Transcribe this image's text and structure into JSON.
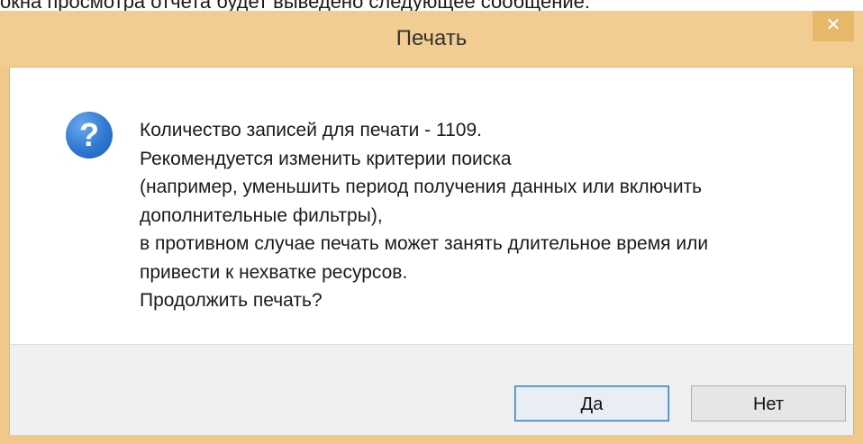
{
  "caption": "окна просмотра отчета будет выведено следующее сообщение:",
  "dialog": {
    "title": "Печать",
    "close_glyph": "✕",
    "icon": "question-icon",
    "icon_glyph": "?",
    "message_lines": [
      "Количество записей для печати - 1109.",
      "Рекомендуется изменить критерии поиска",
      "(например, уменьшить период получения данных или включить",
      "дополнительные фильтры),",
      "в противном случае печать может занять длительное время или",
      "привести к нехватке ресурсов.",
      "Продолжить печать?"
    ],
    "buttons": {
      "yes": "Да",
      "no": "Нет"
    }
  },
  "colors": {
    "titlebar": "#f2cd91",
    "close_button": "#e8b86a",
    "icon": "#2f78d2"
  }
}
